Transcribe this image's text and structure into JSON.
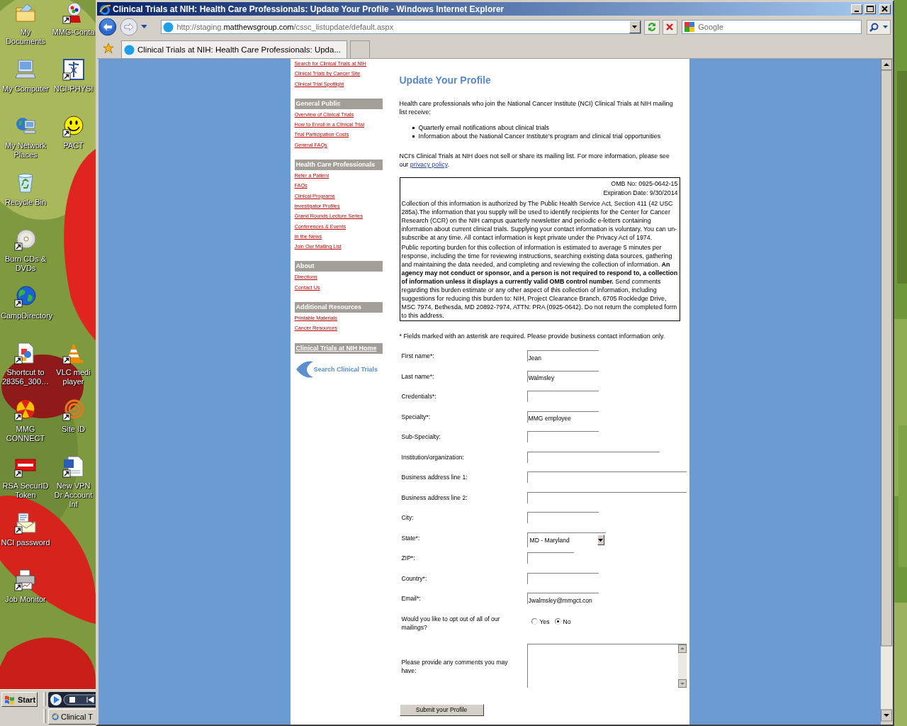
{
  "desktop": {
    "icon_rows": [
      [
        {
          "label": "My Documents",
          "kind": "folder",
          "shortcut": false
        },
        {
          "label": "MMG-Conta",
          "kind": "gumball",
          "shortcut": true
        }
      ],
      [
        {
          "label": "My Computer",
          "kind": "computer",
          "shortcut": false
        },
        {
          "label": "NCI-PHYSI",
          "kind": "caduceus",
          "shortcut": true
        }
      ],
      [
        {
          "label": "My Network Places",
          "kind": "network",
          "shortcut": false
        },
        {
          "label": "PACT",
          "kind": "smiley",
          "shortcut": true
        }
      ],
      [
        {
          "label": "Recycle Bin",
          "kind": "recycle",
          "shortcut": false
        }
      ],
      [
        {
          "label": "Burn CDs & DVDs",
          "kind": "disc",
          "shortcut": true
        }
      ],
      [
        {
          "label": "CampDirectory",
          "kind": "globe",
          "shortcut": true
        }
      ],
      [
        {
          "label": "Shortcut to 28356_300…",
          "kind": "document",
          "shortcut": true
        },
        {
          "label": "VLC medi player",
          "kind": "cone",
          "shortcut": true
        }
      ],
      [
        {
          "label": "MMG CONNECT",
          "kind": "radiation",
          "shortcut": true
        },
        {
          "label": "Site ID",
          "kind": "target",
          "shortcut": true
        }
      ],
      [
        {
          "label": "RSA SecurID Token",
          "kind": "card",
          "shortcut": true
        },
        {
          "label": "New VPN Dr Account Inf",
          "kind": "word",
          "shortcut": true
        }
      ],
      [
        {
          "label": "NCI password",
          "kind": "envelope",
          "shortcut": true
        }
      ],
      [
        {
          "label": "Job Monitor",
          "kind": "printer",
          "shortcut": true
        }
      ]
    ]
  },
  "taskbar": {
    "start": "Start",
    "tasks": [
      {
        "label": "Clinical T"
      }
    ]
  },
  "browser": {
    "title": "Clinical Trials at NIH: Health Care Professionals: Update Your Profile - Windows Internet Explorer",
    "address": [
      "http://staging.",
      "matthewsgroup.com",
      "/cssc_listupdate/default.aspx"
    ],
    "search": {
      "placeholder": "Google"
    },
    "tabs": [
      {
        "label": "Clinical Trials at NIH: Health Care Professionals: Upda...",
        "selected": true
      }
    ]
  },
  "nav": {
    "top_links": [
      "Search for Clinical Trials at NIH",
      "Clinical Trials by Cancer Site",
      "Clinical Trial Spotlight"
    ],
    "sections": [
      {
        "heading": "General Public",
        "links": [
          "Overview of Clinical Trials",
          "How to Enroll in a Clinical Trial",
          "Trial Participation Costs",
          "General FAQs"
        ]
      },
      {
        "heading": "Health Care Professionals",
        "links": [
          "Refer a Patient",
          "FAQs",
          "Clinical Programs",
          "Investigator Profiles",
          "Grand Rounds Lecture Series",
          "Conferences & Events",
          "In the News",
          "Join Our Mailing List"
        ]
      },
      {
        "heading": "About",
        "links": [
          "Directions",
          "Contact Us"
        ]
      },
      {
        "heading": "Additional Resources",
        "links": [
          "Printable Materials",
          "Cancer Resources"
        ]
      }
    ],
    "home_link": "Clinical Trials at NIH Home",
    "logo_text": "Search Clinical Trials"
  },
  "main": {
    "title": "Update Your Profile",
    "intro": "Health care professionals who join the National Cancer Institute (NCI) Clinical Trials at NIH mailing list receive:",
    "bullets": [
      "Quarterly email notifications about clinical trials",
      "Information about the National Cancer Institute's program and clinical trial opportunities"
    ],
    "privacy": {
      "text": "NCI's Clinical Trials at NIH does not sell or share its mailing list. For more information, please see our ",
      "link": "privacy policy",
      "after": "."
    },
    "notice": {
      "omb_no": "OMB No: 0925-0642-15",
      "expiration": "Expiration Date: 9/30/2014",
      "paragraphs": [
        "Collection of this information is authorized by The Public Health Service Act, Section 411 (42 USC 285a).The information that you supply will be used to identify recipients for the Center for Cancer Research (CCR) on the NIH campus quarterly newsletter and periodic e-letters containing information about current clinical trials. Supplying your contact information is voluntary. You can un-subscribe at any time. All contact information is kept private under the Privacy Act of 1974.",
        "Public reporting burden for this collection of information is estimated to average 5 minutes per response, including the time for reviewing instructions, searching existing data sources, gathering and maintaining the data needed, and completing and reviewing the collection of information. **An agency may not conduct or sponsor, and a person is not required to respond to, a collection of information unless it displays a currently valid OMB control number.** Send comments regarding this burden estimate or any other aspect of this collection of information, including suggestions for reducing this burden to: NIH, Project Clearance Branch, 6705 Rockledge Drive, MSC 7974, Bethesda, MD 20892-7974, ATTN: PRA (0925-0642). Do not return the completed form to this address."
      ]
    },
    "required_note": "* Fields marked with an asterisk are required. Please provide business contact information only.",
    "fields": [
      {
        "kind": "short",
        "label": "First name*:",
        "value": "Jean"
      },
      {
        "kind": "short",
        "label": "Last name*:",
        "value": "Walmsley"
      },
      {
        "kind": "short",
        "label": "Credentials*:"
      },
      {
        "kind": "short",
        "label": "Specialty*:",
        "value": "MMG employee"
      },
      {
        "kind": "short",
        "label": "Sub-Specialty:"
      },
      {
        "kind": "medium",
        "label": "Institution/organization:"
      },
      {
        "kind": "long",
        "label": "Business address line 1:"
      },
      {
        "kind": "long",
        "label": "Business address line 2:"
      },
      {
        "kind": "short",
        "label": "City:"
      },
      {
        "kind": "select",
        "label": "State*:",
        "value": "MD - Maryland"
      },
      {
        "kind": "tiny",
        "label": "ZIP*:"
      },
      {
        "kind": "short",
        "label": "Country*:"
      },
      {
        "kind": "short",
        "label": "Email*:",
        "value": "Jwalmsley@mmgct.con"
      },
      {
        "kind": "radio",
        "label": "Would you like to opt out of all of our mailings?",
        "options": [
          {
            "label": "Yes",
            "selected": false
          },
          {
            "label": "No",
            "selected": true
          }
        ]
      },
      {
        "kind": "textarea",
        "label": "Please provide any comments you may have:"
      }
    ],
    "submit": "Submit your Profile"
  }
}
